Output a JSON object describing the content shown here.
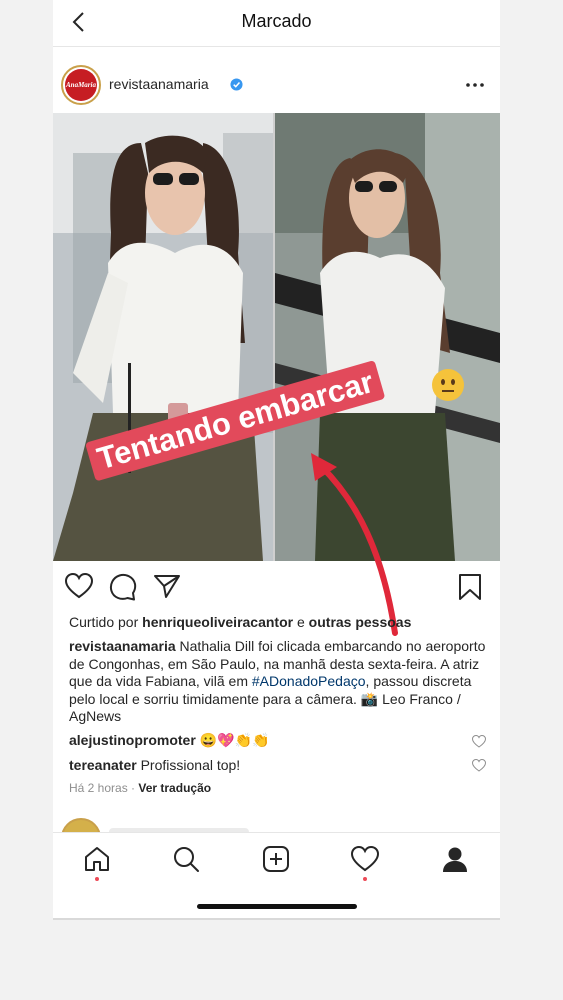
{
  "header": {
    "title": "Marcado"
  },
  "post": {
    "username": "revistaanamaria",
    "avatar_text": "AnaMaria",
    "sticker_text": "Tentando embarcar",
    "liked_by_prefix": "Curtido por",
    "liked_by_user": "henriqueoliveiracantor",
    "liked_by_connector": "e",
    "liked_by_others": "outras pessoas",
    "caption_user": "revistaanamaria",
    "caption_part1": "Nathalia Dill foi clicada embarcando no aeroporto de Congonhas, em São Paulo, na manhã desta sexta-feira. A atriz que da vida Fabiana, vilã em",
    "caption_hashtag": "#ADonadoPedaço",
    "caption_part2": ", passou discreta pelo local e sorriu timidamente para a câmera. 📸 Leo Franco / AgNews",
    "comments": [
      {
        "user": "alejustinopromoter",
        "text": "😀💖👏👏"
      },
      {
        "user": "tereanater",
        "text": "Profissional top!"
      }
    ],
    "time": "Há 2 horas",
    "translate": "Ver tradução"
  },
  "colors": {
    "sticker": "#e24a5b",
    "arrow": "#e0283a",
    "hashtag": "#00376b",
    "notification_dot": "#ed4956"
  },
  "icons": [
    "back-icon",
    "verified-icon",
    "more-icon",
    "heart-icon",
    "comment-icon",
    "share-icon",
    "save-icon",
    "home-icon",
    "search-icon",
    "new-post-icon",
    "activity-icon",
    "profile-icon"
  ]
}
